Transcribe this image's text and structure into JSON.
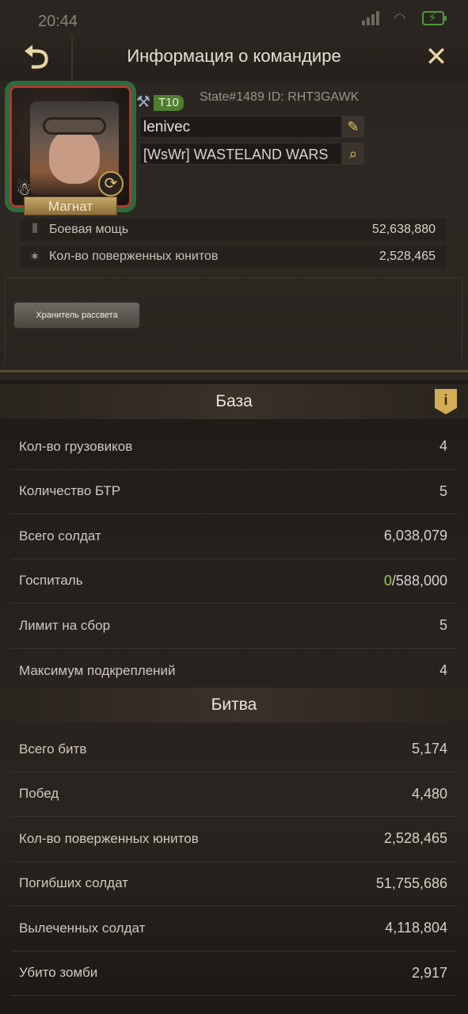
{
  "status_bar": {
    "time": "20:44"
  },
  "header": {
    "title": "Информация о командире"
  },
  "profile": {
    "rank_badge": "Магнат",
    "tier": "T10",
    "state_id": "State#1489 ID: RHT3GAWK",
    "name": "lenivec",
    "alliance": "[WsWr] WASTELAND WARS",
    "title_badge": "Хранитель рассвета",
    "stats": [
      {
        "icon": "ammo-icon",
        "label": "Боевая мощь",
        "value": "52,638,880"
      },
      {
        "icon": "beast-icon",
        "label": "Кол-во поверженных юнитов",
        "value": "2,528,465"
      }
    ]
  },
  "base": {
    "title": "База",
    "rows": [
      {
        "label": "Кол-во грузовиков",
        "value": "4"
      },
      {
        "label": "Количество БТР",
        "value": "5"
      },
      {
        "label": "Всего солдат",
        "value": "6,038,079"
      },
      {
        "label": "Госпиталь",
        "value_current": "0",
        "value_rest": "/588,000"
      },
      {
        "label": "Лимит на сбор",
        "value": "5"
      },
      {
        "label": "Максимум подкреплений",
        "value": "4"
      }
    ]
  },
  "battle": {
    "title": "Битва",
    "rows": [
      {
        "label": "Всего битв",
        "value": "5,174"
      },
      {
        "label": "Побед",
        "value": "4,480"
      },
      {
        "label": "Кол-во поверженных юнитов",
        "value": "2,528,465"
      },
      {
        "label": "Погибших солдат",
        "value": "51,755,686"
      },
      {
        "label": "Вылеченных солдат",
        "value": "4,118,804"
      },
      {
        "label": "Убито зомби",
        "value": "2,917"
      }
    ]
  },
  "colors": {
    "accent_gold": "#e5c26a",
    "tier_green": "#4f7d2e",
    "hospital_green": "#98c85a"
  }
}
